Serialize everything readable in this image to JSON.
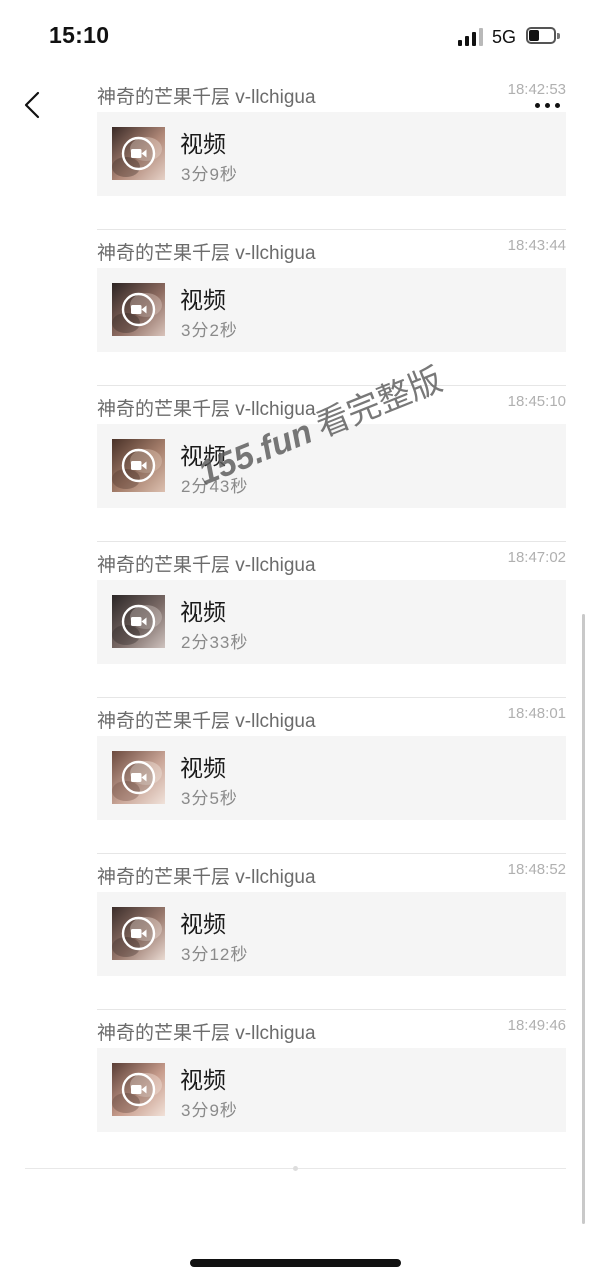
{
  "status_bar": {
    "time": "15:10",
    "network": "5G",
    "signal_icon": "cellular-signal-icon",
    "battery_icon": "battery-icon",
    "battery_level": 0.3
  },
  "nav": {
    "back_icon": "chevron-left-icon",
    "more_icon": "ellipsis-icon"
  },
  "messages": [
    {
      "sender": "神奇的芒果千层 v-llchigua",
      "time": "18:42:53",
      "title": "视频",
      "duration": "3分9秒",
      "thumb_colors": [
        "#3a2a26",
        "#b08878",
        "#e6d2c8"
      ]
    },
    {
      "sender": "神奇的芒果千层 v-llchigua",
      "time": "18:43:44",
      "title": "视频",
      "duration": "3分2秒",
      "thumb_colors": [
        "#2d2423",
        "#8d6b60",
        "#d9c4bb"
      ]
    },
    {
      "sender": "神奇的芒果千层 v-llchigua",
      "time": "18:45:10",
      "title": "视频",
      "duration": "2分43秒",
      "thumb_colors": [
        "#4a3228",
        "#a67f6c",
        "#dcc0b0"
      ]
    },
    {
      "sender": "神奇的芒果千层 v-llchigua",
      "time": "18:47:02",
      "title": "视频",
      "duration": "2分33秒",
      "thumb_colors": [
        "#2b2626",
        "#7a6a66",
        "#cfc3bf"
      ]
    },
    {
      "sender": "神奇的芒果千层 v-llchigua",
      "time": "18:48:01",
      "title": "视频",
      "duration": "3分5秒",
      "thumb_colors": [
        "#6c4a3e",
        "#c9a597",
        "#f0e2da"
      ]
    },
    {
      "sender": "神奇的芒果千层 v-llchigua",
      "time": "18:48:52",
      "title": "视频",
      "duration": "3分12秒",
      "thumb_colors": [
        "#3b2d2a",
        "#9a7a6e",
        "#eadbd3"
      ]
    },
    {
      "sender": "神奇的芒果千层 v-llchigua",
      "time": "18:49:46",
      "title": "视频",
      "duration": "3分9秒",
      "thumb_colors": [
        "#5a3e36",
        "#c79c8c",
        "#f1e1d8"
      ]
    }
  ],
  "play_icon": "video-camera-play-icon",
  "watermark": {
    "domain": "155.fun",
    "text": "看完整版"
  }
}
